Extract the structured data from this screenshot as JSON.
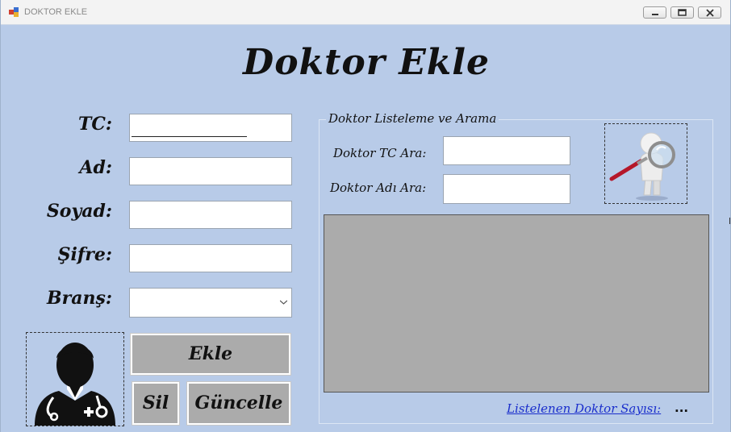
{
  "window": {
    "title": "DOKTOR EKLE",
    "controls": [
      "minimize",
      "maximize",
      "close"
    ]
  },
  "form": {
    "title": "Doktor Ekle",
    "fields": {
      "tc": {
        "label": "TC:",
        "value": ""
      },
      "ad": {
        "label": "Ad:",
        "value": ""
      },
      "soyad": {
        "label": "Soyad:",
        "value": ""
      },
      "sifre": {
        "label": "Şifre:",
        "value": ""
      },
      "brans": {
        "label": "Branş:",
        "selected": ""
      }
    },
    "buttons": {
      "ekle": "Ekle",
      "sil": "Sil",
      "guncelle": "Güncelle"
    }
  },
  "search": {
    "group_title": "Doktor Listeleme ve Arama",
    "tc_label": "Doktor TC Ara:",
    "tc_value": "",
    "name_label": "Doktor Adı Ara:",
    "name_value": ""
  },
  "footer": {
    "count_label": "Listelenen Doktor Sayısı:",
    "count_value": "..."
  },
  "icons": {
    "doctor": "doctor-avatar-icon",
    "search": "magnifier-figure-icon"
  },
  "colors": {
    "background": "#b8cbe8",
    "button": "#ababab",
    "grid": "#ababab",
    "link": "#1a2ecc"
  }
}
